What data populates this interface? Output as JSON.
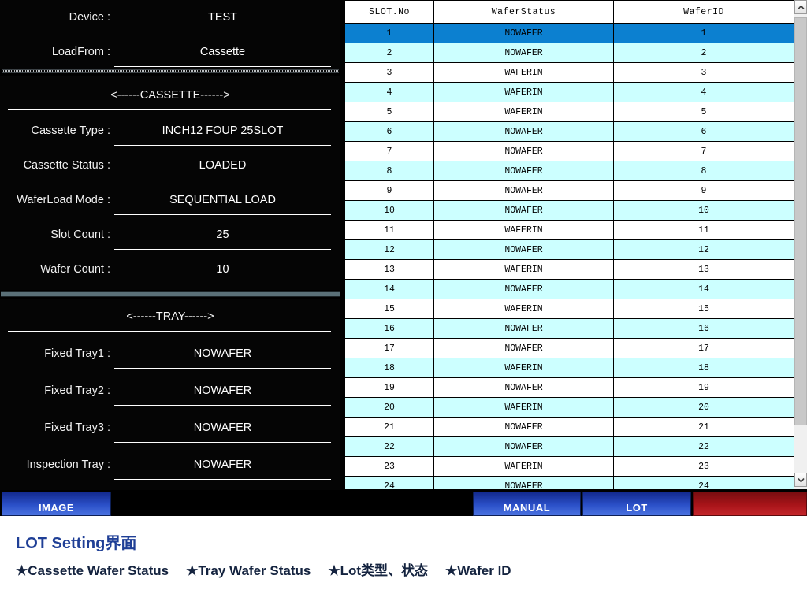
{
  "left_panel": {
    "device_section": {
      "fields": [
        {
          "label": "Device :",
          "value": "TEST"
        },
        {
          "label": "LoadFrom :",
          "value": "Cassette"
        }
      ]
    },
    "cassette_section": {
      "heading": "<------CASSETTE------>",
      "fields": [
        {
          "label": "Cassette Type :",
          "value": "INCH12 FOUP 25SLOT"
        },
        {
          "label": "Cassette Status :",
          "value": "LOADED"
        },
        {
          "label": "WaferLoad Mode :",
          "value": "SEQUENTIAL LOAD"
        },
        {
          "label": "Slot Count :",
          "value": "25"
        },
        {
          "label": "Wafer Count :",
          "value": "10"
        }
      ]
    },
    "tray_section": {
      "heading": "<------TRAY------>",
      "fields": [
        {
          "label": "Fixed Tray1 :",
          "value": "NOWAFER"
        },
        {
          "label": "Fixed Tray2 :",
          "value": "NOWAFER"
        },
        {
          "label": "Fixed Tray3 :",
          "value": "NOWAFER"
        },
        {
          "label": "Inspection Tray :",
          "value": "NOWAFER"
        }
      ]
    }
  },
  "slot_table": {
    "columns": [
      "SLOT.No",
      "WaferStatus",
      "WaferID"
    ],
    "selected_row_index": 0,
    "selected_row_color": "#0c80d0",
    "alt_row_color": "#ccffff",
    "rows": [
      {
        "slot": "1",
        "status": "NOWAFER",
        "wafer_id": "1"
      },
      {
        "slot": "2",
        "status": "NOWAFER",
        "wafer_id": "2"
      },
      {
        "slot": "3",
        "status": "WAFERIN",
        "wafer_id": "3"
      },
      {
        "slot": "4",
        "status": "WAFERIN",
        "wafer_id": "4"
      },
      {
        "slot": "5",
        "status": "WAFERIN",
        "wafer_id": "5"
      },
      {
        "slot": "6",
        "status": "NOWAFER",
        "wafer_id": "6"
      },
      {
        "slot": "7",
        "status": "NOWAFER",
        "wafer_id": "7"
      },
      {
        "slot": "8",
        "status": "NOWAFER",
        "wafer_id": "8"
      },
      {
        "slot": "9",
        "status": "NOWAFER",
        "wafer_id": "9"
      },
      {
        "slot": "10",
        "status": "NOWAFER",
        "wafer_id": "10"
      },
      {
        "slot": "11",
        "status": "WAFERIN",
        "wafer_id": "11"
      },
      {
        "slot": "12",
        "status": "NOWAFER",
        "wafer_id": "12"
      },
      {
        "slot": "13",
        "status": "WAFERIN",
        "wafer_id": "13"
      },
      {
        "slot": "14",
        "status": "NOWAFER",
        "wafer_id": "14"
      },
      {
        "slot": "15",
        "status": "WAFERIN",
        "wafer_id": "15"
      },
      {
        "slot": "16",
        "status": "NOWAFER",
        "wafer_id": "16"
      },
      {
        "slot": "17",
        "status": "NOWAFER",
        "wafer_id": "17"
      },
      {
        "slot": "18",
        "status": "WAFERIN",
        "wafer_id": "18"
      },
      {
        "slot": "19",
        "status": "NOWAFER",
        "wafer_id": "19"
      },
      {
        "slot": "20",
        "status": "WAFERIN",
        "wafer_id": "20"
      },
      {
        "slot": "21",
        "status": "NOWAFER",
        "wafer_id": "21"
      },
      {
        "slot": "22",
        "status": "NOWAFER",
        "wafer_id": "22"
      },
      {
        "slot": "23",
        "status": "WAFERIN",
        "wafer_id": "23"
      },
      {
        "slot": "24",
        "status": "NOWAFER",
        "wafer_id": "24"
      }
    ]
  },
  "scrollbar": {
    "up_arrow": "chevron-up-icon",
    "down_arrow": "chevron-down-icon"
  },
  "button_bar": {
    "buttons": [
      {
        "label": "IMAGE",
        "color": "#2b50c8"
      },
      {
        "label": "MANUAL",
        "color": "#2b50c8"
      },
      {
        "label": "LOT",
        "color": "#2b50c8"
      },
      {
        "label": "",
        "color": "#a81419"
      }
    ]
  },
  "caption": {
    "title": "LOT Setting界面",
    "bullets": [
      "★Cassette Wafer Status",
      "★Tray Wafer Status",
      "★Lot类型、状态",
      "★Wafer ID"
    ],
    "title_color": "#1f3f96",
    "bullets_color": "#14233f"
  }
}
